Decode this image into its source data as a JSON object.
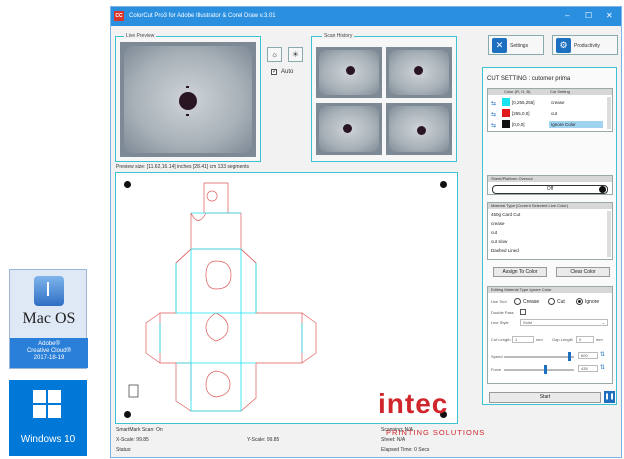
{
  "app": {
    "title": "ColorCut Pro3 for Adobe Illustrator & Corel Draw  v.3.01",
    "minimize": "–",
    "maximize": "☐",
    "close": "✕"
  },
  "live_preview": {
    "label": "Live Preview",
    "auto_label": "Auto",
    "auto_checked": true
  },
  "scan_history": {
    "label": "Scan History"
  },
  "preview_info": "Preview size: [11.62,16.14] inches   [28.41] cm    133 segments",
  "toolbar": {
    "settings_label": "Settings",
    "productivity_label": "Productivity"
  },
  "cut_setting": {
    "title": "CUT SETTING : cutomer prima",
    "table_headers": [
      "Color (R, G, B)",
      "Cut Setting"
    ],
    "rows": [
      {
        "rgb": "[0,255,255]",
        "setting": "crease",
        "color": "#19e3f0"
      },
      {
        "rgb": "[255,0,0]",
        "setting": "cut",
        "color": "#e01b1b"
      },
      {
        "rgb": "[0,0,0]",
        "setting": "Ignore Color",
        "color": "#111111"
      }
    ]
  },
  "sheet_border": {
    "label": "Sheet/Platform Overcut",
    "value": "Off"
  },
  "material": {
    "label": "Material Type (Current Selected Line Color)",
    "items": [
      "450g Card Cut",
      "crease",
      "cut",
      "cut slow",
      "Dashed Lined"
    ]
  },
  "buttons": {
    "assign": "Assign To Color",
    "clear": "Clear Color",
    "start": "Start"
  },
  "editing": {
    "label": "Editing Material Type Ignore Color",
    "line_type_label": "Use Tool",
    "options": [
      "Crease",
      "Cut",
      "Ignore"
    ],
    "selected": "Ignore",
    "double_pass_label": "Double Pass",
    "line_style_label": "Line Style",
    "line_style_value": "Solid",
    "cut_length_label": "Cut Length",
    "cut_length_value": "1",
    "cut_length_unit": "mm",
    "gap_label": "Gap Length",
    "gap_value": "0",
    "gap_unit": "mm",
    "speed_label": "Speed",
    "speed_value": "600",
    "force_label": "Force",
    "force_value": "435"
  },
  "status": {
    "smartmark": "SmartMark Scan: On",
    "xscale": "X-Scale: 99.85",
    "yscale": "Y-Scale: 99.85",
    "status": "Status:",
    "scanning": "Scanning: N/A",
    "sheet": "Sheet: N/A",
    "elapsed": "Elapsed Time: 0 Secs"
  },
  "brand": {
    "name": "intec",
    "tagline": "PRINTING SOLUTIONS"
  },
  "badges": {
    "mac_text": "Mac OS",
    "mac_sub1": "Adobe®",
    "mac_sub2": "Creative Cloud®",
    "mac_sub3": "2017-18-19",
    "win_text": "Windows 10"
  },
  "colors": {
    "titlebar": "#2b8fe0",
    "accent": "#3ec1d3",
    "brand": "#d0262b",
    "cut_line": "#e05a5a",
    "crease_line": "#19e3f0"
  }
}
